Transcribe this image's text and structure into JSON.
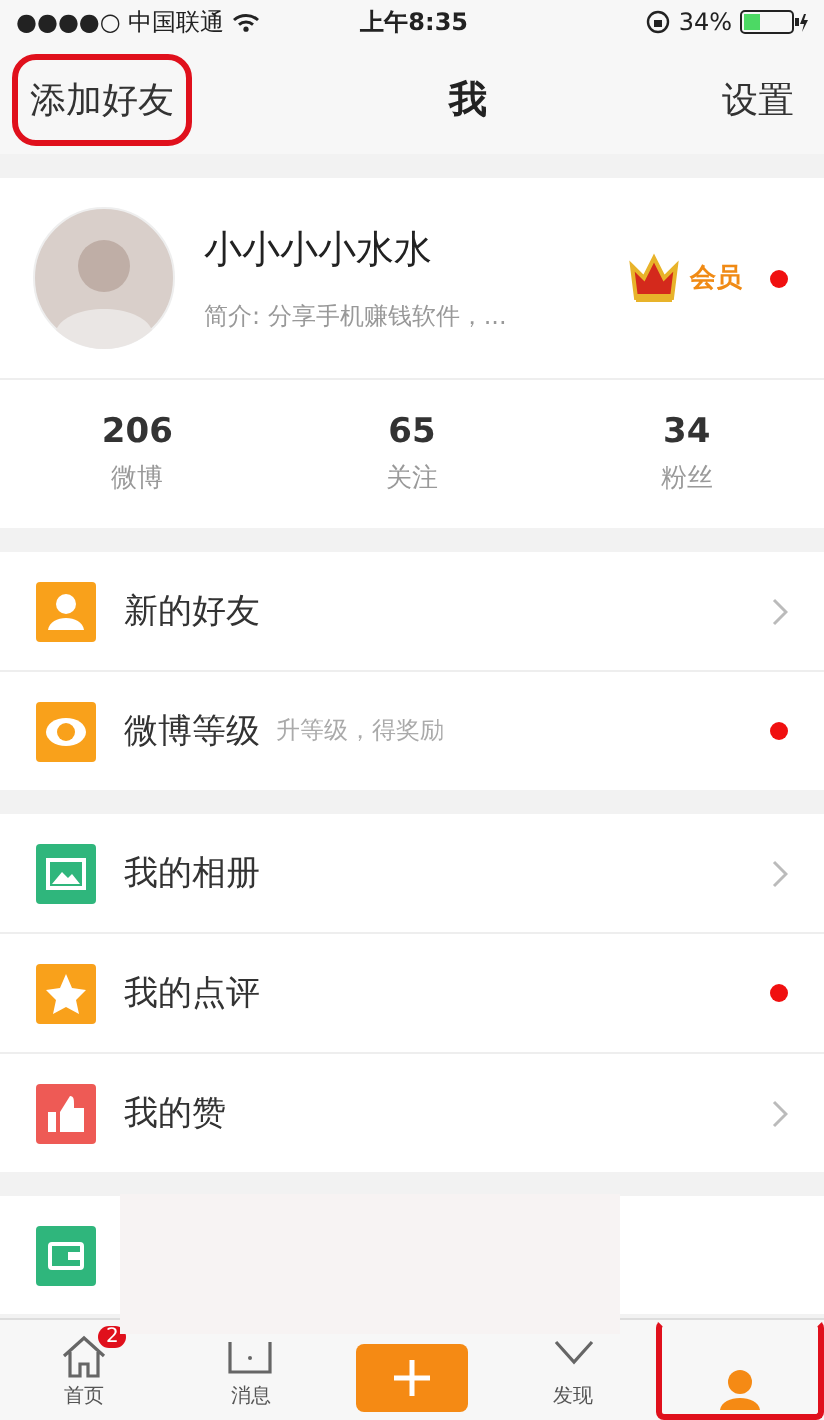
{
  "status_bar": {
    "carrier": "●●●●○ 中国联通",
    "time": "上午8:35",
    "battery": "34%"
  },
  "nav": {
    "left": {
      "label": "添加好友",
      "highlighted": true
    },
    "title": "我",
    "right": "设置"
  },
  "profile": {
    "name": "小小小小水水",
    "bio": "简介: 分享手机赚钱软件，...",
    "vip": "会员",
    "vip_dot": true
  },
  "stats": [
    {
      "value": "206",
      "label": "微博"
    },
    {
      "value": "65",
      "label": "关注"
    },
    {
      "value": "34",
      "label": "粉丝"
    }
  ],
  "menu_groups": [
    [
      {
        "kind": "friend",
        "label": "新的好友",
        "dot": false
      },
      {
        "kind": "level",
        "label": "微博等级",
        "hint": "升等级，得奖励",
        "dot": true
      }
    ],
    [
      {
        "kind": "album",
        "label": "我的相册",
        "dot": false
      },
      {
        "kind": "review",
        "label": "我的点评",
        "dot": true
      },
      {
        "kind": "like",
        "label": "我的赞",
        "dot": false
      }
    ],
    [
      {
        "kind": "wallet"
      }
    ]
  ],
  "tab_bar": [
    {
      "kind": "home",
      "label": "首页",
      "badge": "2",
      "selected": false,
      "highlighted": false
    },
    {
      "kind": "message",
      "label": "消息",
      "selected": false,
      "highlighted": false
    },
    {
      "kind": "compose"
    },
    {
      "kind": "discover",
      "label": "发现",
      "selected": false,
      "highlighted": false
    },
    {
      "kind": "me",
      "selected": true,
      "highlighted": true
    }
  ]
}
